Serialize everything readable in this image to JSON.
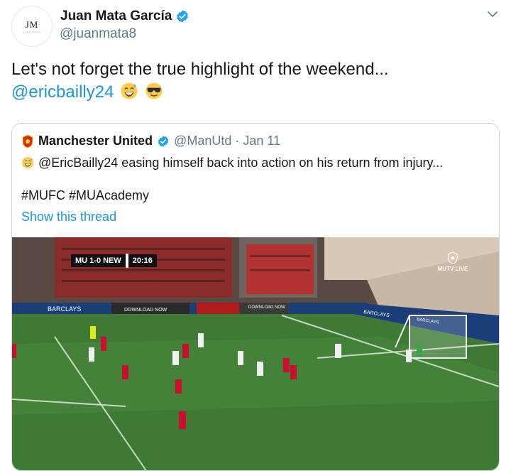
{
  "author": {
    "display_name": "Juan Mata García",
    "handle": "@juanmata8",
    "avatar_monogram": "JM",
    "avatar_subtext": "JUAN MATA"
  },
  "tweet": {
    "text": "Let's not forget the true highlight of the weekend...",
    "mention": "@ericbailly24",
    "emojis": [
      "grinning-sweat-emoji",
      "sunglasses-emoji"
    ]
  },
  "quoted": {
    "display_name": "Manchester United",
    "handle_date": "@ManUtd · Jan 11",
    "text": "@EricBailly24 easing himself back into action on his return from injury...",
    "tags": "#MUFC #MUAcademy",
    "show_thread": "Show this thread"
  },
  "video": {
    "score": "MU 1-0 NEW",
    "clock": "20:16",
    "watermark": "MUTV LIVE",
    "board_1": "BARCLAYS",
    "board_2": "DOWNLOAD NOW",
    "board_3": "DOWNLOAD NOW",
    "board_4": "BARCLAYS",
    "board_5": "BARCLAYS"
  },
  "colors": {
    "link": "#1b95e0",
    "verified": "#1da1f2",
    "muted": "#657786",
    "pitch": "#3f7a35"
  }
}
